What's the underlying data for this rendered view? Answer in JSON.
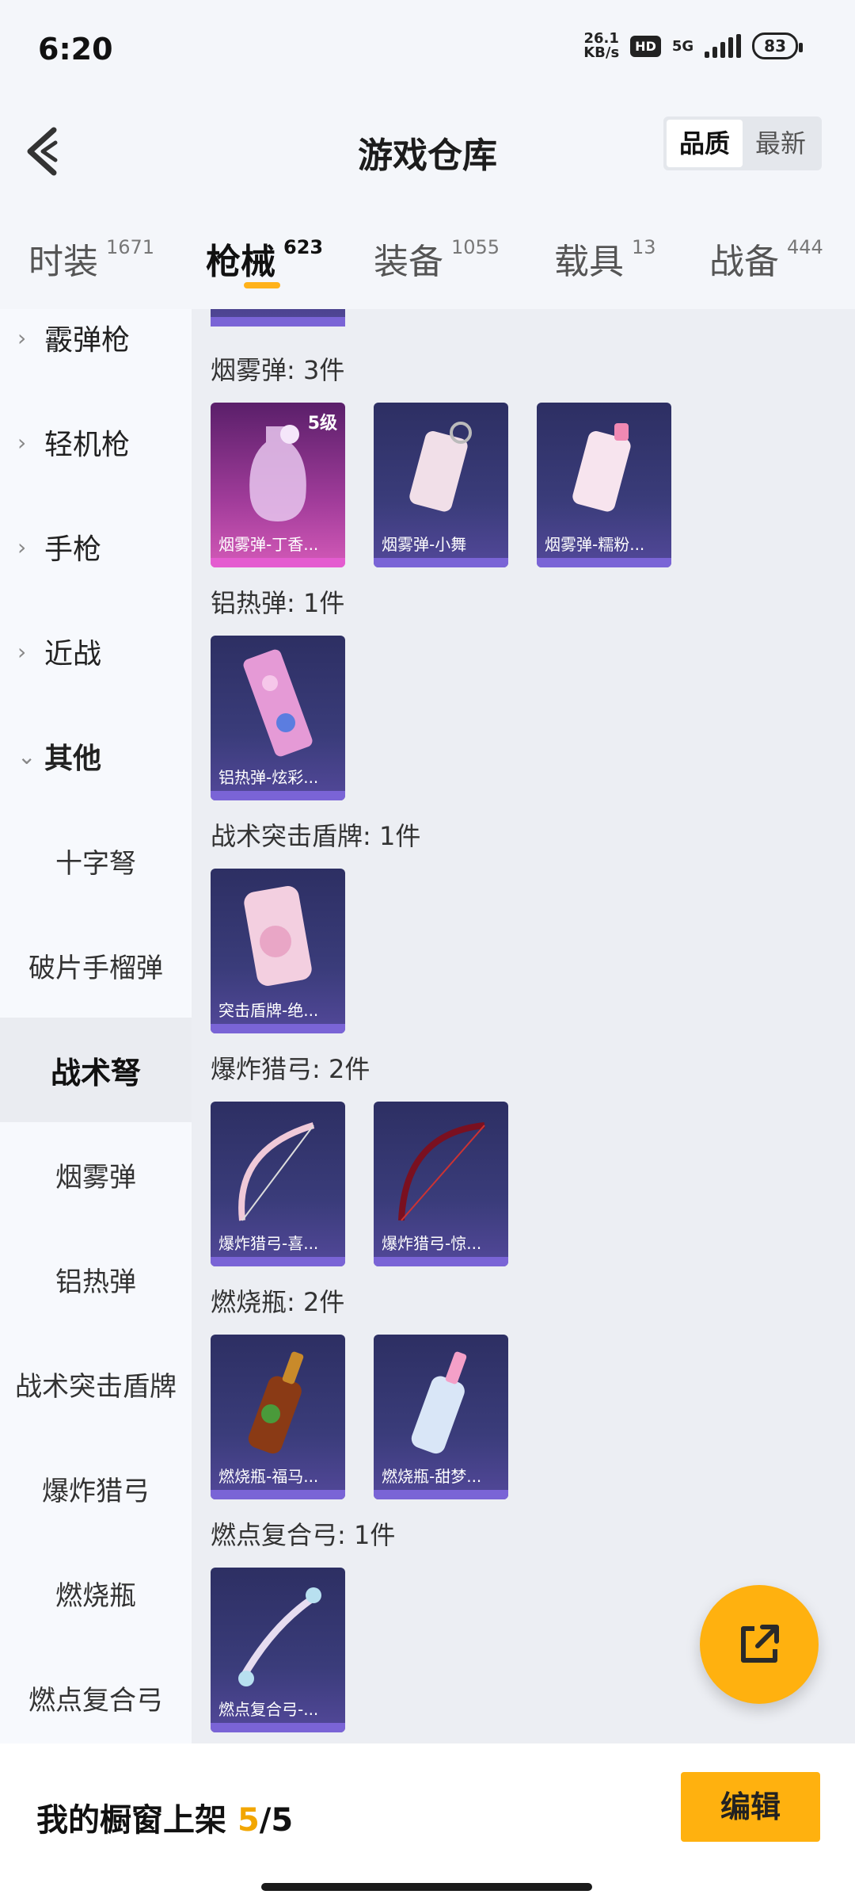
{
  "status": {
    "time": "6:20",
    "speed_top": "26.1",
    "speed_unit": "KB/s",
    "hd": "HD",
    "network": "5G",
    "battery": "83"
  },
  "header": {
    "title": "游戏仓库",
    "sort_quality": "品质",
    "sort_latest": "最新"
  },
  "tabs": [
    {
      "label": "时装",
      "count": "1671"
    },
    {
      "label": "枪械",
      "count": "623"
    },
    {
      "label": "装备",
      "count": "1055"
    },
    {
      "label": "载具",
      "count": "13"
    },
    {
      "label": "战备",
      "count": "444"
    }
  ],
  "sidebar": {
    "parents": [
      {
        "label": "霰弹枪"
      },
      {
        "label": "轻机枪"
      },
      {
        "label": "手枪"
      },
      {
        "label": "近战"
      },
      {
        "label": "其他"
      }
    ],
    "subs": [
      {
        "label": "十字弩"
      },
      {
        "label": "破片手榴弹"
      },
      {
        "label": "战术弩"
      },
      {
        "label": "烟雾弹"
      },
      {
        "label": "铝热弹"
      },
      {
        "label": "战术突击盾牌"
      },
      {
        "label": "爆炸猎弓"
      },
      {
        "label": "燃烧瓶"
      },
      {
        "label": "燃点复合弓"
      }
    ]
  },
  "sections": [
    {
      "title": "烟雾弹: 3件",
      "items": [
        {
          "name": "烟雾弹-丁香...",
          "level": "5级",
          "icon": "smoke-bottle-icon"
        },
        {
          "name": "烟雾弹-小舞",
          "icon": "smoke-canister-icon"
        },
        {
          "name": "烟雾弹-糯粉...",
          "icon": "smoke-canister-icon"
        }
      ]
    },
    {
      "title": "铝热弹: 1件",
      "items": [
        {
          "name": "铝热弹-炫彩...",
          "icon": "thermite-icon"
        }
      ]
    },
    {
      "title": "战术突击盾牌: 1件",
      "items": [
        {
          "name": "突击盾牌-绝...",
          "icon": "shield-icon"
        }
      ]
    },
    {
      "title": "爆炸猎弓: 2件",
      "items": [
        {
          "name": "爆炸猎弓-喜...",
          "icon": "bow-icon"
        },
        {
          "name": "爆炸猎弓-惊...",
          "icon": "bow-icon"
        }
      ]
    },
    {
      "title": "燃烧瓶: 2件",
      "items": [
        {
          "name": "燃烧瓶-福马...",
          "icon": "molotov-icon"
        },
        {
          "name": "燃烧瓶-甜梦...",
          "icon": "molotov-icon"
        }
      ]
    },
    {
      "title": "燃点复合弓: 1件",
      "items": [
        {
          "name": "燃点复合弓-...",
          "icon": "compound-bow-icon"
        }
      ]
    }
  ],
  "bottom": {
    "label": "我的橱窗上架",
    "current": "5",
    "total": "/5",
    "edit": "编辑"
  },
  "colors": {
    "accent": "#ffb10f",
    "card_blue": "#3a3c7a",
    "card_pink": "#a13c9a"
  }
}
